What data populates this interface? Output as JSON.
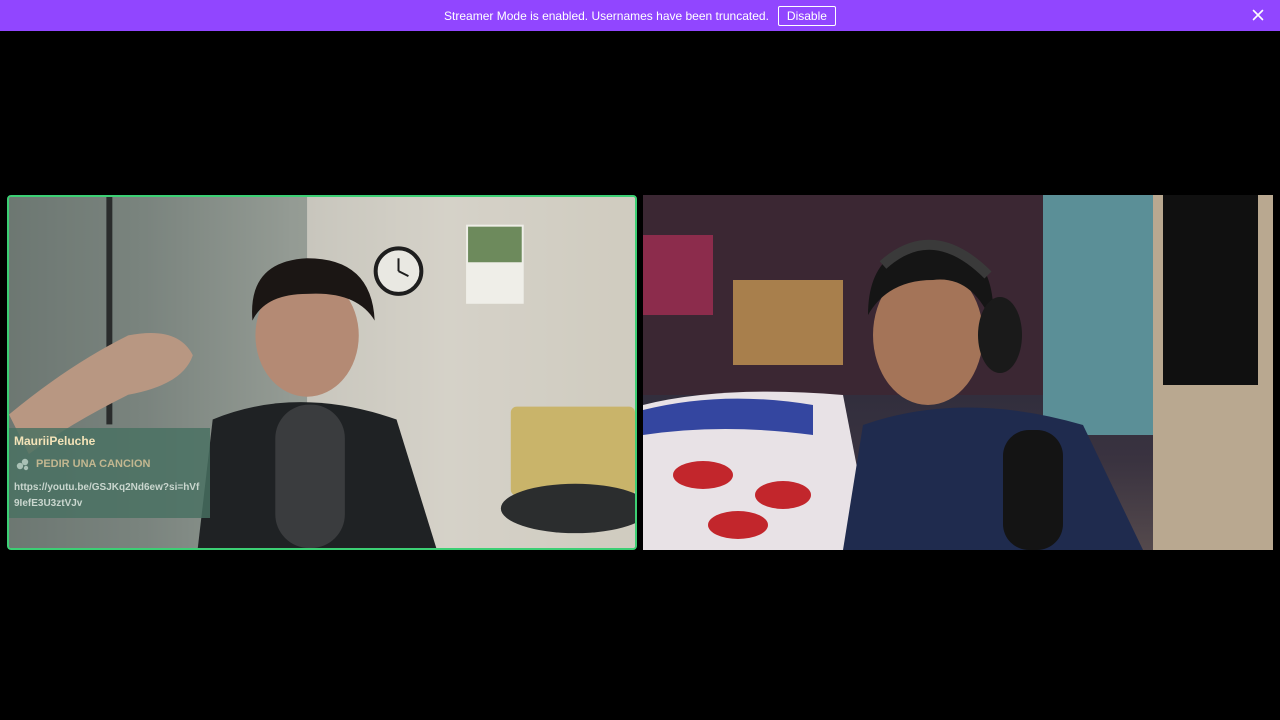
{
  "banner": {
    "message": "Streamer Mode is enabled. Usernames have been truncated.",
    "disable_label": "Disable",
    "background": "#9146ff"
  },
  "tiles": {
    "left": {
      "highlight_color": "#3ccf74",
      "chat": {
        "username": "MauriiPeluche",
        "reward_icon": "channel-points-icon",
        "reward_label": "PEDIR UNA CANCION",
        "link": "https://youtu.be/GSJKq2Nd6ew?si=hVf9IefE3U3ztVJv"
      }
    },
    "right": {}
  },
  "icons": {
    "close": "close-icon"
  }
}
